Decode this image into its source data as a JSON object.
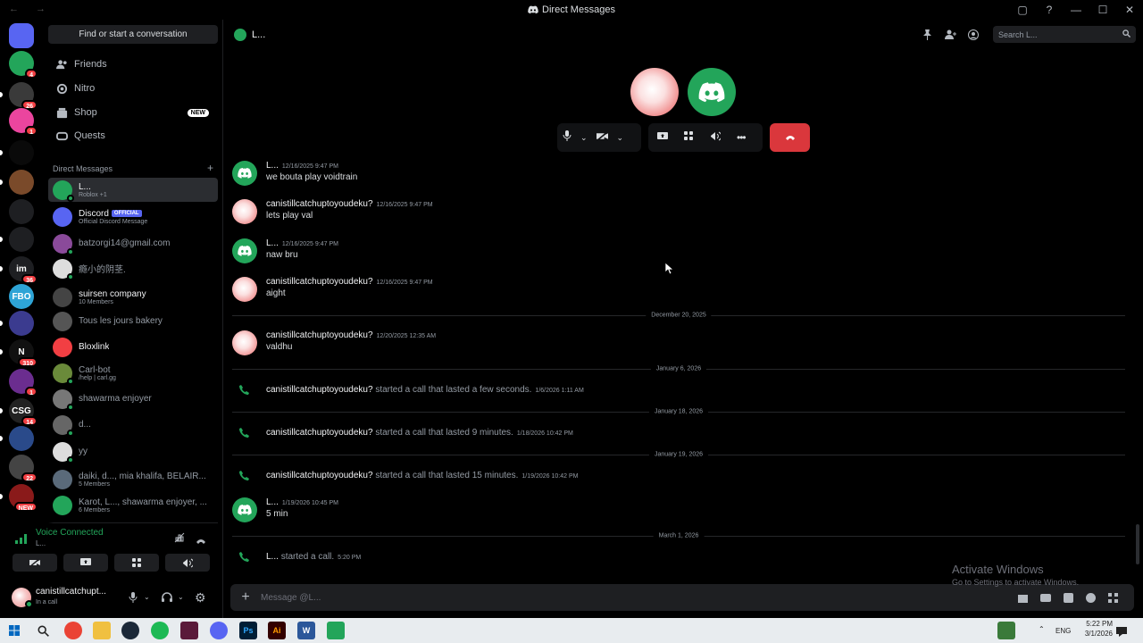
{
  "window": {
    "title": "Direct Messages",
    "nav": "← →",
    "controls": [
      "▢",
      "?",
      "—",
      "☐",
      "✕"
    ]
  },
  "guilds": [
    {
      "name": "discord-home",
      "color": "#5865f2",
      "label": "",
      "badge": ""
    },
    {
      "name": "dm-avatar",
      "color": "#23a55a",
      "label": "",
      "badge": "4"
    },
    {
      "name": "server-1",
      "color": "#3a3a3a",
      "label": "",
      "badge": "26"
    },
    {
      "name": "server-2",
      "color": "#eb459e",
      "label": "",
      "badge": "1"
    },
    {
      "name": "server-3",
      "color": "#0a0a0a",
      "label": "",
      "badge": ""
    },
    {
      "name": "server-4",
      "color": "#7a4a2a",
      "label": "",
      "badge": ""
    },
    {
      "name": "server-5",
      "color": "#1e1f22",
      "label": "",
      "badge": ""
    },
    {
      "name": "server-6",
      "color": "#1e1f22",
      "label": "",
      "badge": ""
    },
    {
      "name": "server-7",
      "color": "#1e1f22",
      "label": "im",
      "badge": "36"
    },
    {
      "name": "server-8",
      "color": "#2ea4d6",
      "label": "FBO",
      "badge": ""
    },
    {
      "name": "server-9",
      "color": "#3b3b8f",
      "label": "",
      "badge": ""
    },
    {
      "name": "server-10",
      "color": "#111",
      "label": "N",
      "badge": "310"
    },
    {
      "name": "server-11",
      "color": "#6b2d8f",
      "label": "",
      "badge": "1"
    },
    {
      "name": "server-12",
      "color": "#222",
      "label": "CSG",
      "badge": "14"
    },
    {
      "name": "server-13",
      "color": "#2a4a8a",
      "label": "",
      "badge": ""
    },
    {
      "name": "server-14",
      "color": "#444",
      "label": "",
      "badge": "22"
    },
    {
      "name": "server-15",
      "color": "#8a1a1a",
      "label": "",
      "badge": "NEW"
    }
  ],
  "sidebar": {
    "find_label": "Find or start a conversation",
    "nav": [
      {
        "label": "Friends",
        "icon": "friends-icon"
      },
      {
        "label": "Nitro",
        "icon": "nitro-icon"
      },
      {
        "label": "Shop",
        "icon": "shop-icon",
        "badge": "NEW"
      },
      {
        "label": "Quests",
        "icon": "quests-icon"
      }
    ],
    "dm_header": "Direct Messages",
    "dm_add": "+",
    "dms": [
      {
        "name": "L...",
        "sub": "Roblox +1",
        "color": "#23a55a",
        "status": "#23a55a",
        "active": true,
        "bright": true
      },
      {
        "name": "Discord",
        "sub": "Official Discord Message",
        "color": "#5865f2",
        "official": "OFFICIAL",
        "bright": true
      },
      {
        "name": "batzorgi14@gmail.com",
        "sub": "",
        "color": "#8a4a9a",
        "status": "#23a55a"
      },
      {
        "name": "瘾小的阴茎.",
        "sub": "",
        "color": "#ddd",
        "status": "#23a55a"
      },
      {
        "name": "suirsen company",
        "sub": "10 Members",
        "color": "#444",
        "bright": true
      },
      {
        "name": "Tous les jours bakery",
        "sub": "",
        "color": "#555"
      },
      {
        "name": "Bloxlink",
        "sub": "",
        "color": "#f23f43",
        "bright": true
      },
      {
        "name": "Carl-bot",
        "sub": "/help | carl.gg",
        "color": "#6a8a3a",
        "status": "#23a55a"
      },
      {
        "name": "shawarma enjoyer",
        "sub": "",
        "color": "#777",
        "status": "#23a55a"
      },
      {
        "name": "d...",
        "sub": "",
        "color": "#666",
        "status": "#23a55a"
      },
      {
        "name": "yy",
        "sub": "",
        "color": "#ddd",
        "status": "#23a55a"
      },
      {
        "name": "daiki, d..., mia khalifa, BELAIR...",
        "sub": "5 Members",
        "color": "#5a6a7a"
      },
      {
        "name": "Karot, L..., shawarma enjoyer, ...",
        "sub": "6 Members",
        "color": "#23a55a"
      }
    ],
    "voice": {
      "title": "Voice Connected",
      "sub": "L..."
    },
    "user": {
      "name": "canistillcatchupt...",
      "status": "In a call"
    }
  },
  "channel": {
    "name": "L...",
    "search_placeholder": "Search L..."
  },
  "messages": [
    {
      "type": "msg",
      "author": "L...",
      "time": "12/16/2025 9:47 PM",
      "body": "we bouta play voidtrain",
      "avatar": "discord"
    },
    {
      "type": "msg",
      "author": "canistillcatchuptoyoudeku?",
      "time": "12/16/2025 9:47 PM",
      "body": "lets play val",
      "avatar": "pink"
    },
    {
      "type": "msg",
      "author": "L...",
      "time": "12/16/2025 9:47 PM",
      "body": "naw bru",
      "avatar": "discord"
    },
    {
      "type": "msg",
      "author": "canistillcatchuptoyoudeku?",
      "time": "12/16/2025 9:47 PM",
      "body": "aight",
      "avatar": "pink"
    },
    {
      "type": "divider",
      "label": "December 20, 2025"
    },
    {
      "type": "msg",
      "author": "canistillcatchuptoyoudeku?",
      "time": "12/20/2025 12:35 AM",
      "body": "valdhu",
      "avatar": "pink"
    },
    {
      "type": "divider",
      "label": "January 6, 2026"
    },
    {
      "type": "call",
      "author": "canistillcatchuptoyoudeku?",
      "text": "started a call that lasted a few seconds.",
      "time": "1/6/2026 1:11 AM"
    },
    {
      "type": "divider",
      "label": "January 18, 2026"
    },
    {
      "type": "call",
      "author": "canistillcatchuptoyoudeku?",
      "text": "started a call that lasted 9 minutes.",
      "time": "1/18/2026 10:42 PM"
    },
    {
      "type": "divider",
      "label": "January 19, 2026"
    },
    {
      "type": "call",
      "author": "canistillcatchuptoyoudeku?",
      "text": "started a call that lasted 15 minutes.",
      "time": "1/19/2026 10:42 PM"
    },
    {
      "type": "msg",
      "author": "L...",
      "time": "1/19/2026 10:45 PM",
      "body": "5 min",
      "avatar": "discord"
    },
    {
      "type": "divider",
      "label": "March 1, 2026"
    },
    {
      "type": "call",
      "author": "L...",
      "text": "started a call.",
      "time": "5:20 PM"
    }
  ],
  "composer": {
    "placeholder": "Message @L..."
  },
  "activation": {
    "title": "Activate Windows",
    "sub": "Go to Settings to activate Windows."
  },
  "taskbar": {
    "lang": "ENG",
    "time": "5:22 PM",
    "date": "3/1/2026"
  }
}
